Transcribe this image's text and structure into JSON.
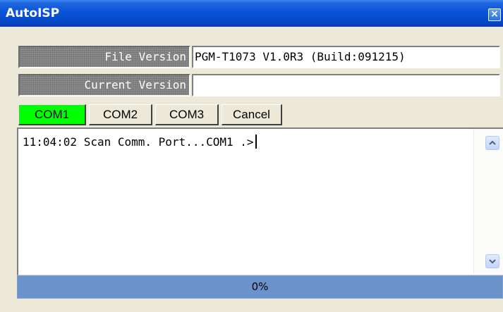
{
  "window": {
    "title": "AutoISP",
    "close_glyph": "×",
    "accent_color": "#0a53d9"
  },
  "info": {
    "file_version_label": "File Version",
    "file_version_value": "PGM-T1073 V1.0R3 (Build:091215)",
    "current_version_label": "Current Version",
    "current_version_value": ""
  },
  "buttons": {
    "com1": "COM1",
    "com2": "COM2",
    "com3": "COM3",
    "cancel": "Cancel",
    "active_color": "#00ff00"
  },
  "log": {
    "text": "11:04:02 Scan Comm. Port...COM1 .>"
  },
  "scrollbar": {
    "up_icon": "chevron-up-icon",
    "down_icon": "chevron-down-icon"
  },
  "progress": {
    "fraction": 0,
    "label": "0%",
    "bar_color": "#6a93cc"
  }
}
